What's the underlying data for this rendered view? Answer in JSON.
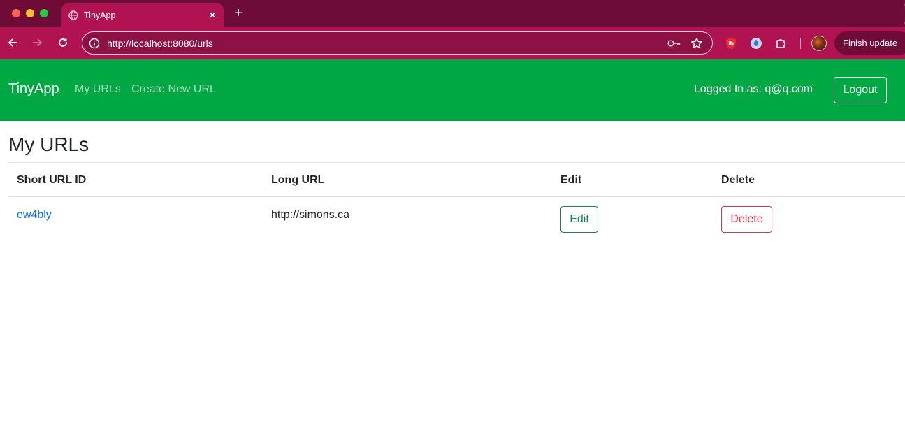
{
  "browser": {
    "tab": {
      "title": "TinyApp",
      "icon": "globe-icon"
    },
    "new_tab_icon": "plus-icon",
    "address_bar": {
      "url": "http://localhost:8080/urls"
    },
    "finish_update_label": "Finish update",
    "colors": {
      "tabstrip": "#6f0b37",
      "toolbar": "#b0134f"
    }
  },
  "navbar": {
    "brand": "TinyApp",
    "links": [
      "My URLs",
      "Create New URL"
    ],
    "logged_in_text": "Logged In as: q@q.com",
    "logout_label": "Logout",
    "color": "#00a843"
  },
  "main": {
    "title": "My URLs",
    "table": {
      "headers": [
        "Short URL ID",
        "Long URL",
        "Edit",
        "Delete"
      ],
      "rows": [
        {
          "short_id": "ew4bly",
          "long_url": "http://simons.ca",
          "edit_label": "Edit",
          "delete_label": "Delete"
        }
      ]
    }
  }
}
